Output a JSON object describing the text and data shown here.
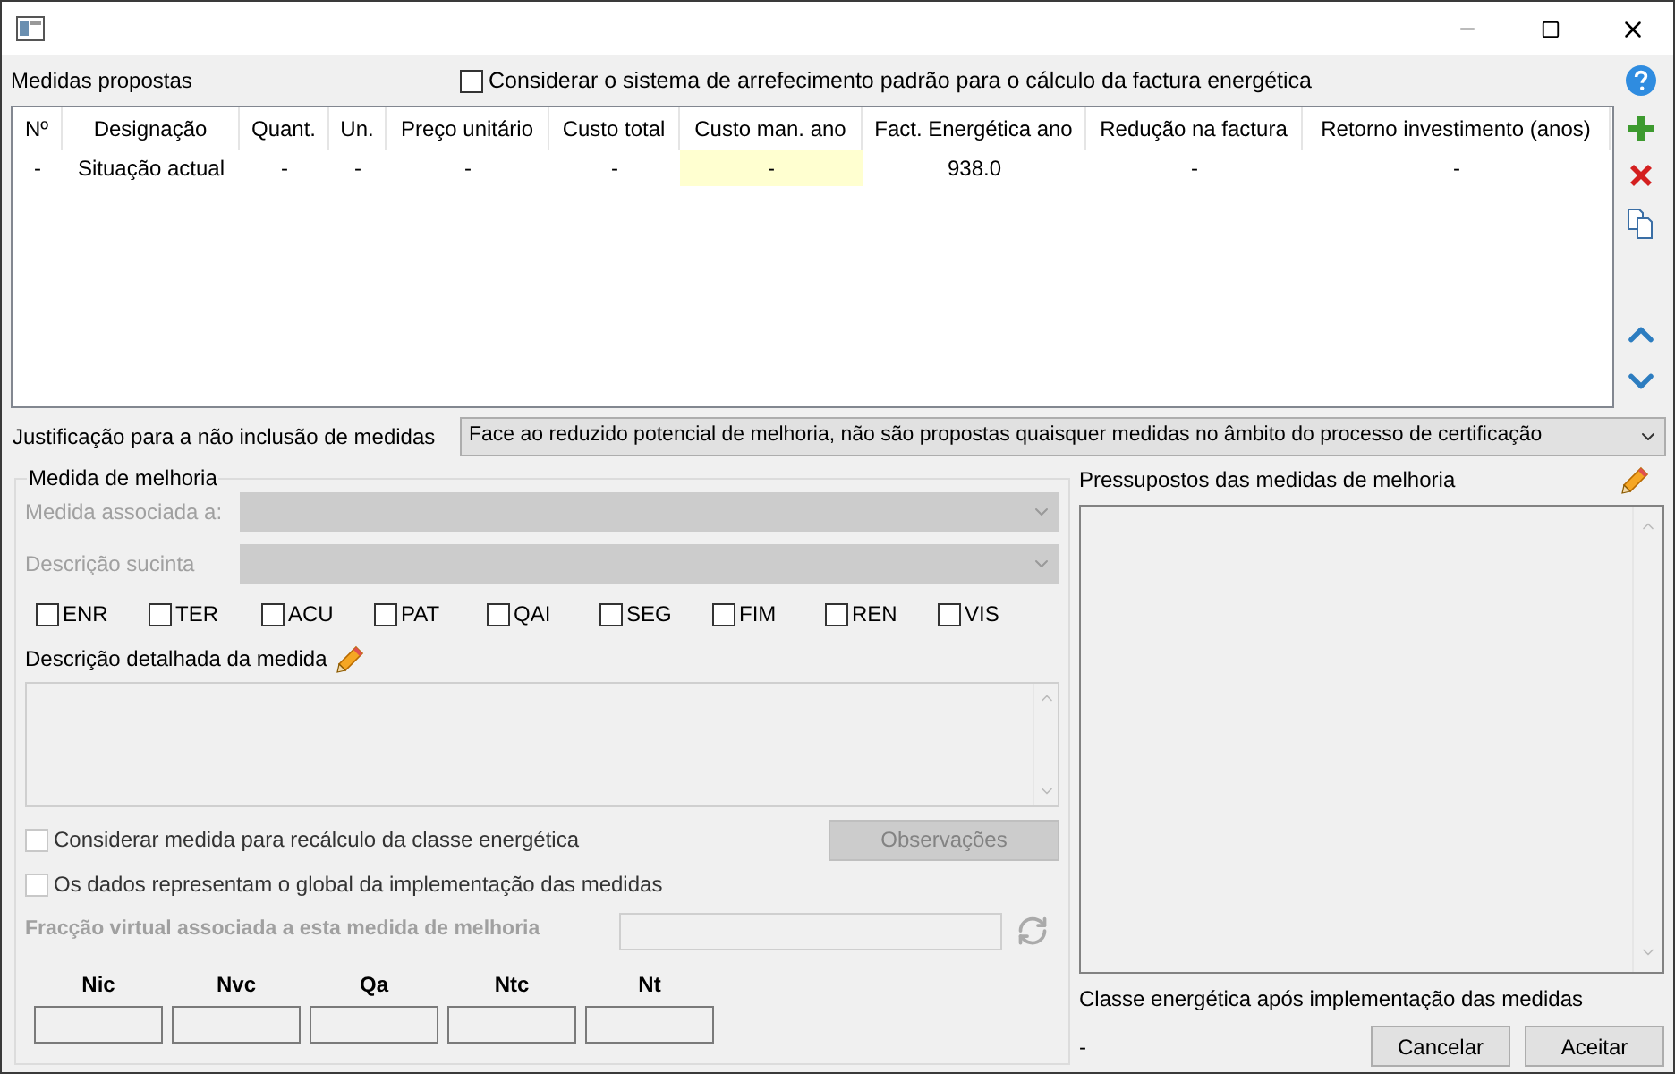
{
  "header": {
    "label": "Medidas propostas",
    "default_cooling": {
      "label": "Considerar o sistema de arrefecimento padrão para o cálculo da factura energética",
      "checked": false
    }
  },
  "table": {
    "columns": [
      "Nº",
      "Designação",
      "Quant.",
      "Un.",
      "Preço unitário",
      "Custo total",
      "Custo man. ano",
      "Fact. Energética ano",
      "Redução na factura",
      "Retorno investimento (anos)"
    ],
    "rows": [
      {
        "cells": [
          {
            "text": "-",
            "highlighted": false
          },
          {
            "text": "Situação actual",
            "highlighted": false
          },
          {
            "text": "-",
            "highlighted": false
          },
          {
            "text": "-",
            "highlighted": false
          },
          {
            "text": "-",
            "highlighted": false
          },
          {
            "text": "-",
            "highlighted": false
          },
          {
            "text": "-",
            "highlighted": true
          },
          {
            "text": "938.0",
            "highlighted": false
          },
          {
            "text": "-",
            "highlighted": false
          },
          {
            "text": "-",
            "highlighted": false
          }
        ]
      }
    ]
  },
  "justification": {
    "label": "Justificação para a não inclusão de medidas",
    "value": "Face ao reduzido potencial de melhoria, não são propostas quaisquer medidas no âmbito do processo de certificação"
  },
  "measure": {
    "title": "Medida de melhoria",
    "associated": {
      "label": "Medida associada a:",
      "disabled": true
    },
    "short_description": {
      "label": "Descrição sucinta",
      "disabled": true
    },
    "categories": [
      {
        "label": "ENR",
        "checked": false
      },
      {
        "label": "TER",
        "checked": false
      },
      {
        "label": "ACU",
        "checked": false
      },
      {
        "label": "PAT",
        "checked": false
      },
      {
        "label": "QAI",
        "checked": false
      },
      {
        "label": "SEG",
        "checked": false
      },
      {
        "label": "FIM",
        "checked": false
      },
      {
        "label": "REN",
        "checked": false
      },
      {
        "label": "VIS",
        "checked": false
      }
    ],
    "detail_label": "Descrição detalhada da medida",
    "recalc": {
      "label": "Considerar medida para recálculo da classe energética",
      "checked": false
    },
    "observations_button": {
      "label": "Observações",
      "disabled": true
    },
    "global": {
      "label": "Os dados representam o global da implementação das medidas",
      "checked": false
    },
    "virtual_fraction": {
      "label": "Fracção virtual associada a esta medida de melhoria",
      "disabled": true
    },
    "indicators": [
      "Nic",
      "Nvc",
      "Qa",
      "Ntc",
      "Nt"
    ]
  },
  "assumptions": {
    "label": "Pressupostos das medidas de melhoria"
  },
  "class_after": {
    "label": "Classe energética após implementação das medidas",
    "value": "-"
  },
  "buttons": [
    {
      "label": "Cancelar"
    },
    {
      "label": "Aceitar"
    }
  ]
}
